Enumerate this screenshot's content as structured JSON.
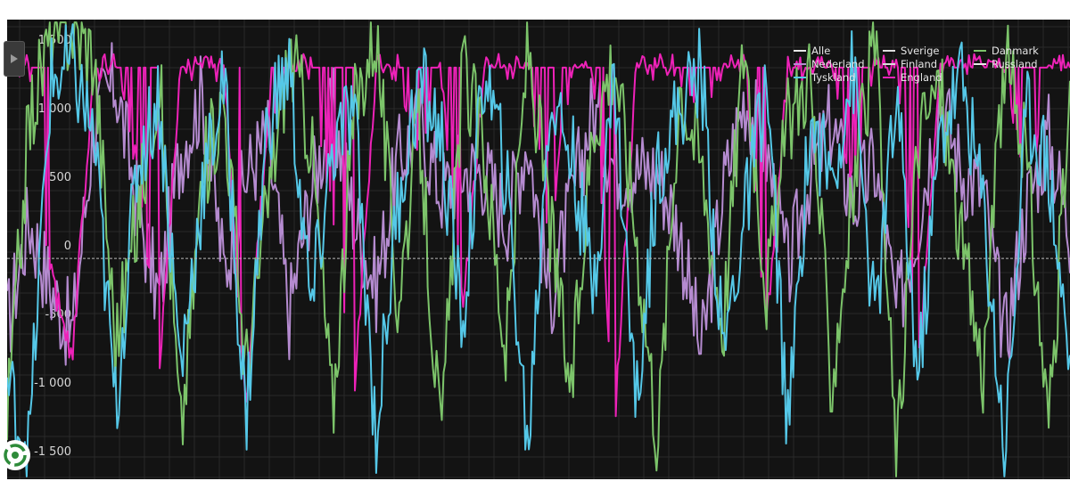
{
  "chart_data": {
    "type": "line",
    "title": "",
    "xlabel": "",
    "ylabel": "",
    "ylim": [
      -1700,
      1650
    ],
    "y_ticks": [
      1500,
      1000,
      500,
      0,
      -500,
      -1000,
      -1500
    ],
    "y_tick_labels": [
      "1 500",
      "1 000",
      "500",
      "0",
      "-500",
      "-1 000",
      "-1 500"
    ],
    "n_points": 600,
    "grid": true,
    "legend_position": "top-right",
    "series": [
      {
        "name": "Alle",
        "color": "#e8e8e8",
        "values": []
      },
      {
        "name": "Sverige",
        "color": "#dcdcdc",
        "values": []
      },
      {
        "name": "Danmark",
        "color": "#7cc46a",
        "values": [
          -1300,
          900,
          1550,
          1600,
          1400,
          -700,
          200,
          1300,
          -1400,
          500,
          1100,
          -900,
          300,
          1450,
          800,
          -1200,
          1000,
          1600,
          -400,
          900,
          -1500,
          1300,
          700,
          -800,
          1500,
          200,
          -1100,
          900,
          1400,
          100,
          -1400,
          1200,
          600,
          -600,
          1550,
          -300,
          900,
          1300,
          -1000,
          400,
          1500,
          -1600,
          800,
          1200,
          0,
          -900,
          1400,
          600,
          -1300,
          1000
        ]
      },
      {
        "name": "Nederland",
        "color": "#b58bd0",
        "values": [
          -600,
          200,
          -300,
          -650,
          900,
          1200,
          300,
          -400,
          700,
          1100,
          -200,
          500,
          800,
          -500,
          400,
          1000,
          200,
          -300,
          600,
          900,
          400,
          550,
          550,
          200,
          800,
          -400,
          300,
          1000,
          600,
          550,
          550,
          100,
          -800,
          400,
          1100,
          700,
          -200,
          500,
          900,
          300,
          600,
          -500,
          200,
          1100,
          550,
          400,
          -700,
          300,
          800,
          100
        ]
      },
      {
        "name": "Finland",
        "color": "#dcdcdc",
        "values": []
      },
      {
        "name": "Russland",
        "color": "#e8e8e8",
        "values": []
      },
      {
        "name": "Tyskland",
        "color": "#55c8e8",
        "values": [
          -1000,
          -1500,
          1200,
          1300,
          800,
          -1200,
          600,
          1100,
          -900,
          400,
          1200,
          -1300,
          900,
          1300,
          -500,
          700,
          1000,
          -1400,
          300,
          1200,
          800,
          -600,
          1300,
          500,
          -1500,
          1100,
          700,
          -300,
          1250,
          -1200,
          600,
          1000,
          1300,
          -800,
          200,
          1200,
          -1400,
          900,
          500,
          1300,
          -600,
          1100,
          -1000,
          800,
          1250,
          300,
          -1500,
          1000,
          600,
          -900
        ]
      },
      {
        "name": "England",
        "color": "#ee22b8",
        "values": [
          1300,
          1300,
          -200,
          -800,
          1300,
          1300,
          600,
          -900,
          1300,
          1300,
          1300,
          -1200,
          900,
          1300,
          1300,
          200,
          -1100,
          1300,
          1300,
          700,
          1300,
          -500,
          1300,
          1300,
          1300,
          100,
          1300,
          1300,
          -1300,
          1300,
          1300,
          1300,
          800,
          1300,
          1300,
          -600,
          1300,
          1300,
          1300,
          400,
          1300,
          1300,
          -900,
          1300,
          1300,
          1300,
          1300,
          300,
          1300,
          1300
        ]
      }
    ]
  },
  "ui": {
    "collapse_icon": "triangle-right-icon",
    "logo_icon": "recycle-badge-icon"
  }
}
